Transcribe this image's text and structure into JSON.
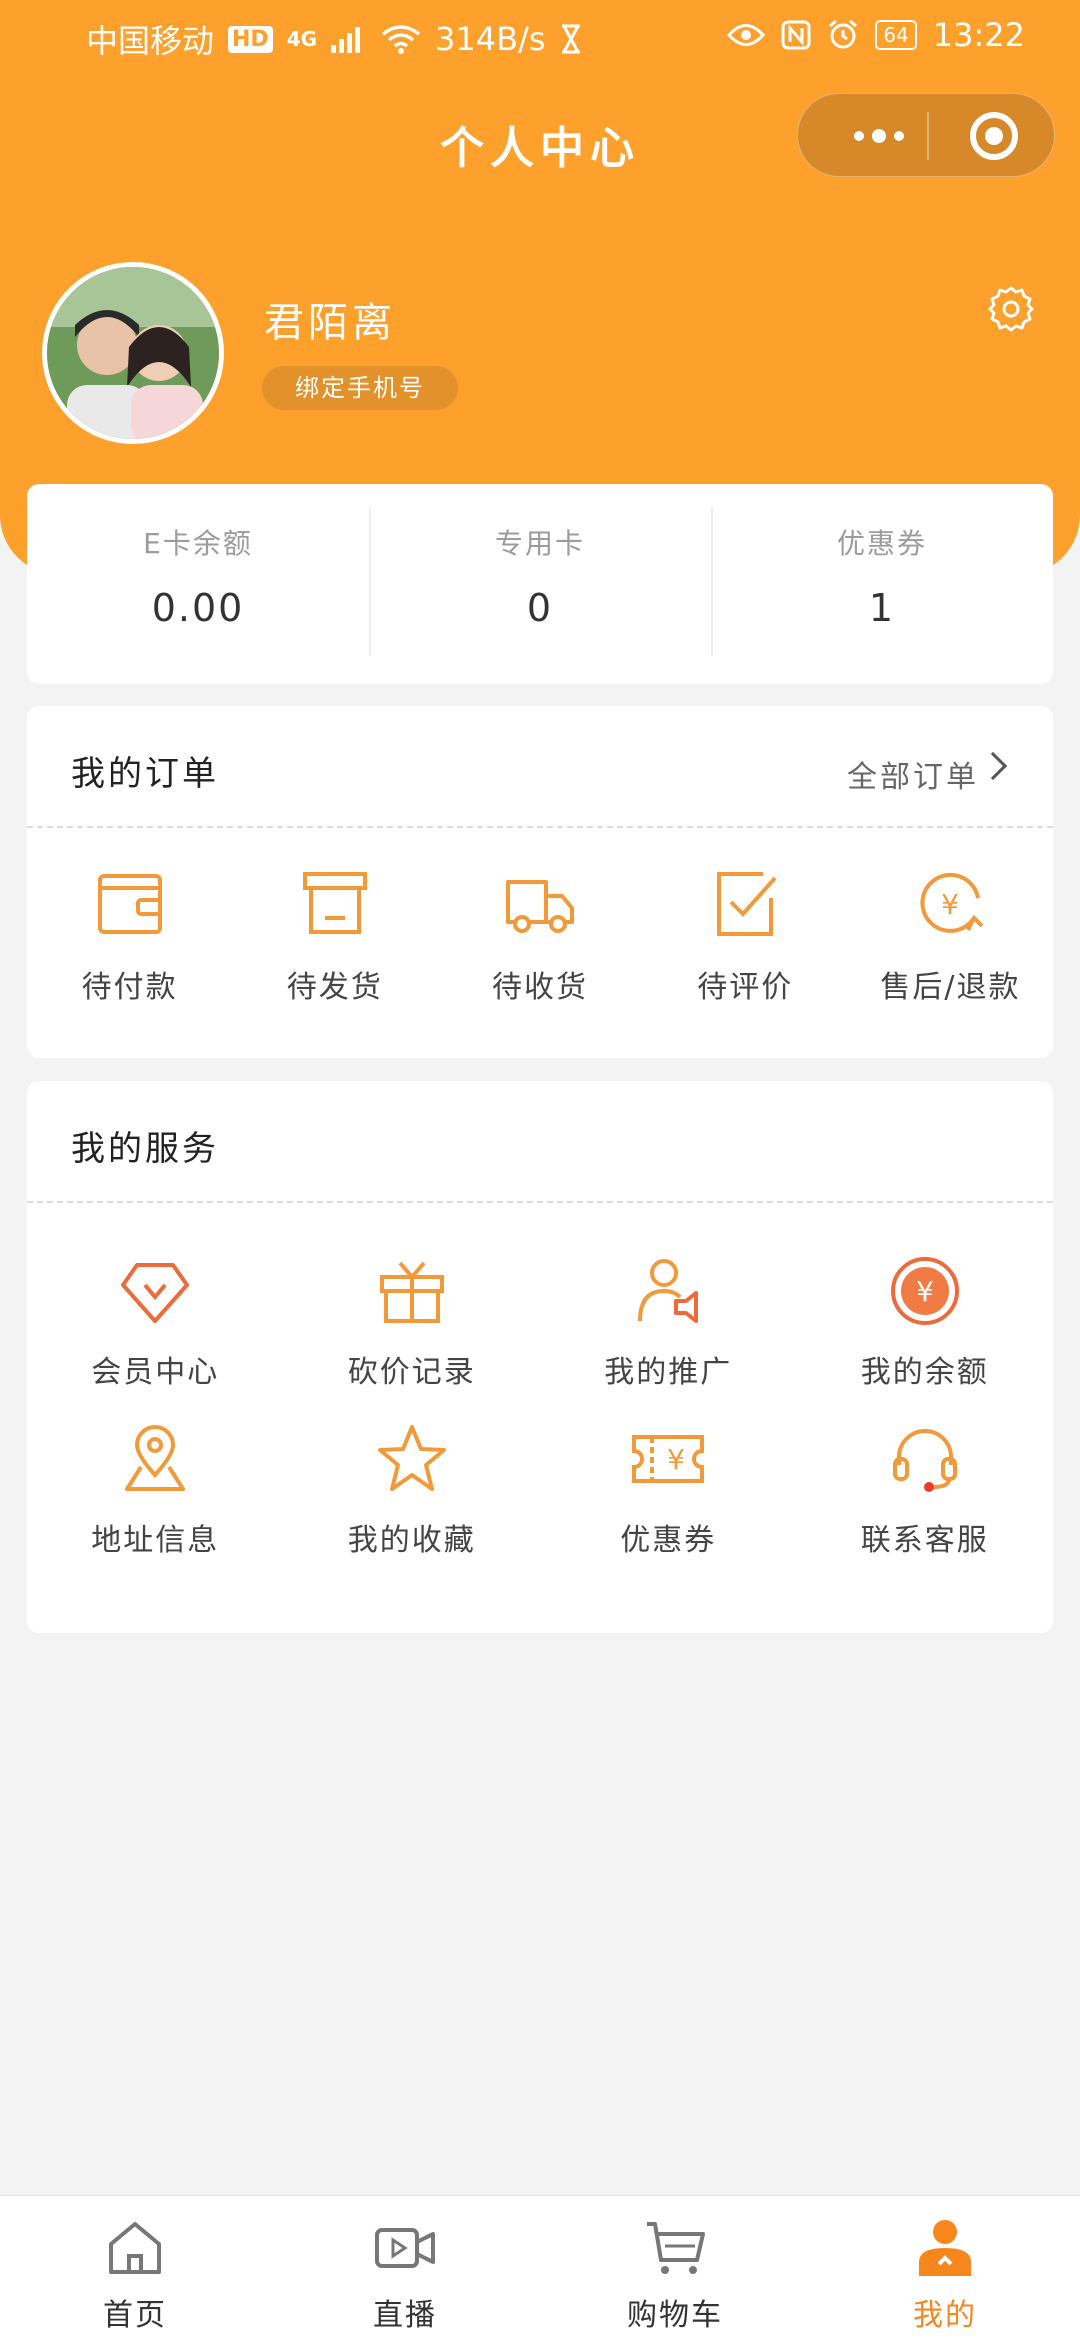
{
  "status_bar": {
    "carrier": "中国移动",
    "hd": "HD",
    "network": "4G",
    "speed": "314B/s",
    "battery": "64",
    "time": "13:22"
  },
  "nav": {
    "title": "个人中心"
  },
  "profile": {
    "username": "君陌离",
    "bind_phone_label": "绑定手机号"
  },
  "balance": [
    {
      "label": "E卡余额",
      "value": "0.00"
    },
    {
      "label": "专用卡",
      "value": "0"
    },
    {
      "label": "优惠券",
      "value": "1"
    }
  ],
  "orders": {
    "title": "我的订单",
    "all_label": "全部订单",
    "items": [
      {
        "label": "待付款",
        "icon": "wallet-icon"
      },
      {
        "label": "待发货",
        "icon": "package-icon"
      },
      {
        "label": "待收货",
        "icon": "truck-icon"
      },
      {
        "label": "待评价",
        "icon": "review-icon"
      },
      {
        "label": "售后/退款",
        "icon": "refund-icon"
      }
    ]
  },
  "services": {
    "title": "我的服务",
    "items": [
      {
        "label": "会员中心",
        "icon": "diamond-icon"
      },
      {
        "label": "砍价记录",
        "icon": "gift-icon"
      },
      {
        "label": "我的推广",
        "icon": "promote-icon"
      },
      {
        "label": "我的余额",
        "icon": "yuan-coin-icon"
      },
      {
        "label": "地址信息",
        "icon": "location-icon"
      },
      {
        "label": "我的收藏",
        "icon": "star-icon"
      },
      {
        "label": "优惠券",
        "icon": "ticket-icon"
      },
      {
        "label": "联系客服",
        "icon": "headset-icon"
      }
    ]
  },
  "tabbar": [
    {
      "label": "首页",
      "icon": "home-icon"
    },
    {
      "label": "直播",
      "icon": "video-icon"
    },
    {
      "label": "购物车",
      "icon": "cart-icon"
    },
    {
      "label": "我的",
      "icon": "user-icon",
      "active": true
    }
  ],
  "colors": {
    "brand": "#fda12c",
    "icon": "#f29a3a",
    "active_tab": "#f7861d",
    "background": "#f3f3f4"
  }
}
